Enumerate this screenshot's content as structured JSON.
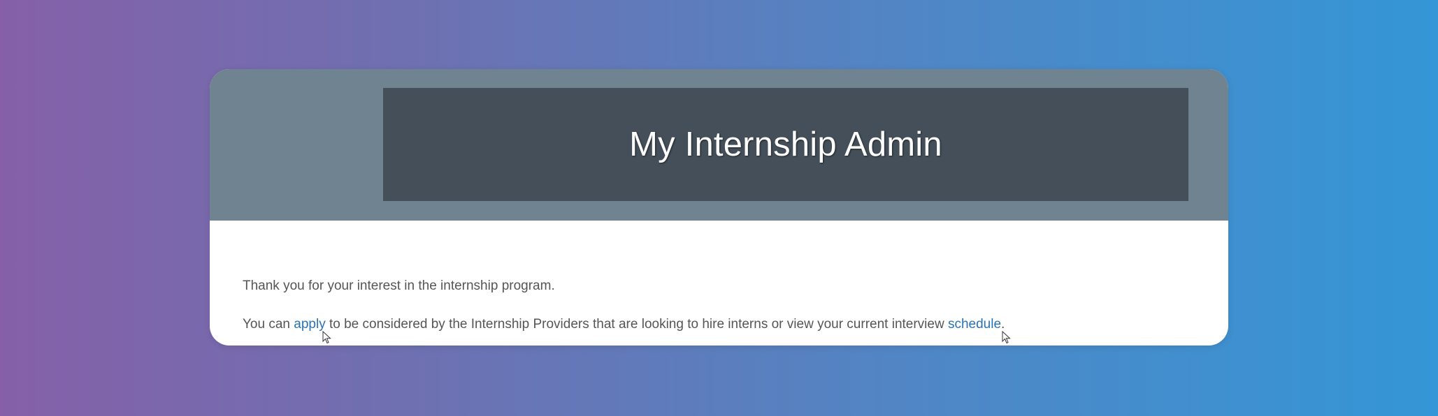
{
  "header": {
    "title": "My Internship Admin"
  },
  "body": {
    "intro": "Thank you for your interest in the internship program.",
    "text_before_apply": "You can ",
    "apply_link": "apply",
    "text_middle": " to be considered by the Internship Providers that are looking to hire interns or view your current interview ",
    "schedule_link": "schedule",
    "text_end": "."
  },
  "colors": {
    "header_band": "#708390",
    "title_box": "#444f59",
    "link": "#2a73b3",
    "gradient_start": "#8560a8",
    "gradient_end": "#3496d6"
  }
}
